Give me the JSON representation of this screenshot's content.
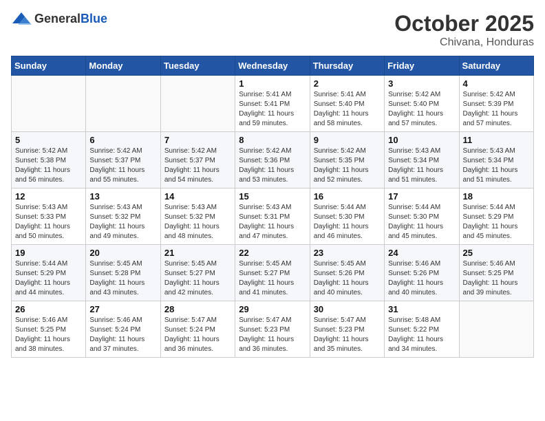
{
  "header": {
    "logo_general": "General",
    "logo_blue": "Blue",
    "month": "October 2025",
    "location": "Chivana, Honduras"
  },
  "weekdays": [
    "Sunday",
    "Monday",
    "Tuesday",
    "Wednesday",
    "Thursday",
    "Friday",
    "Saturday"
  ],
  "weeks": [
    [
      {
        "day": "",
        "info": ""
      },
      {
        "day": "",
        "info": ""
      },
      {
        "day": "",
        "info": ""
      },
      {
        "day": "1",
        "info": "Sunrise: 5:41 AM\nSunset: 5:41 PM\nDaylight: 11 hours\nand 59 minutes."
      },
      {
        "day": "2",
        "info": "Sunrise: 5:41 AM\nSunset: 5:40 PM\nDaylight: 11 hours\nand 58 minutes."
      },
      {
        "day": "3",
        "info": "Sunrise: 5:42 AM\nSunset: 5:40 PM\nDaylight: 11 hours\nand 57 minutes."
      },
      {
        "day": "4",
        "info": "Sunrise: 5:42 AM\nSunset: 5:39 PM\nDaylight: 11 hours\nand 57 minutes."
      }
    ],
    [
      {
        "day": "5",
        "info": "Sunrise: 5:42 AM\nSunset: 5:38 PM\nDaylight: 11 hours\nand 56 minutes."
      },
      {
        "day": "6",
        "info": "Sunrise: 5:42 AM\nSunset: 5:37 PM\nDaylight: 11 hours\nand 55 minutes."
      },
      {
        "day": "7",
        "info": "Sunrise: 5:42 AM\nSunset: 5:37 PM\nDaylight: 11 hours\nand 54 minutes."
      },
      {
        "day": "8",
        "info": "Sunrise: 5:42 AM\nSunset: 5:36 PM\nDaylight: 11 hours\nand 53 minutes."
      },
      {
        "day": "9",
        "info": "Sunrise: 5:42 AM\nSunset: 5:35 PM\nDaylight: 11 hours\nand 52 minutes."
      },
      {
        "day": "10",
        "info": "Sunrise: 5:43 AM\nSunset: 5:34 PM\nDaylight: 11 hours\nand 51 minutes."
      },
      {
        "day": "11",
        "info": "Sunrise: 5:43 AM\nSunset: 5:34 PM\nDaylight: 11 hours\nand 51 minutes."
      }
    ],
    [
      {
        "day": "12",
        "info": "Sunrise: 5:43 AM\nSunset: 5:33 PM\nDaylight: 11 hours\nand 50 minutes."
      },
      {
        "day": "13",
        "info": "Sunrise: 5:43 AM\nSunset: 5:32 PM\nDaylight: 11 hours\nand 49 minutes."
      },
      {
        "day": "14",
        "info": "Sunrise: 5:43 AM\nSunset: 5:32 PM\nDaylight: 11 hours\nand 48 minutes."
      },
      {
        "day": "15",
        "info": "Sunrise: 5:43 AM\nSunset: 5:31 PM\nDaylight: 11 hours\nand 47 minutes."
      },
      {
        "day": "16",
        "info": "Sunrise: 5:44 AM\nSunset: 5:30 PM\nDaylight: 11 hours\nand 46 minutes."
      },
      {
        "day": "17",
        "info": "Sunrise: 5:44 AM\nSunset: 5:30 PM\nDaylight: 11 hours\nand 45 minutes."
      },
      {
        "day": "18",
        "info": "Sunrise: 5:44 AM\nSunset: 5:29 PM\nDaylight: 11 hours\nand 45 minutes."
      }
    ],
    [
      {
        "day": "19",
        "info": "Sunrise: 5:44 AM\nSunset: 5:29 PM\nDaylight: 11 hours\nand 44 minutes."
      },
      {
        "day": "20",
        "info": "Sunrise: 5:45 AM\nSunset: 5:28 PM\nDaylight: 11 hours\nand 43 minutes."
      },
      {
        "day": "21",
        "info": "Sunrise: 5:45 AM\nSunset: 5:27 PM\nDaylight: 11 hours\nand 42 minutes."
      },
      {
        "day": "22",
        "info": "Sunrise: 5:45 AM\nSunset: 5:27 PM\nDaylight: 11 hours\nand 41 minutes."
      },
      {
        "day": "23",
        "info": "Sunrise: 5:45 AM\nSunset: 5:26 PM\nDaylight: 11 hours\nand 40 minutes."
      },
      {
        "day": "24",
        "info": "Sunrise: 5:46 AM\nSunset: 5:26 PM\nDaylight: 11 hours\nand 40 minutes."
      },
      {
        "day": "25",
        "info": "Sunrise: 5:46 AM\nSunset: 5:25 PM\nDaylight: 11 hours\nand 39 minutes."
      }
    ],
    [
      {
        "day": "26",
        "info": "Sunrise: 5:46 AM\nSunset: 5:25 PM\nDaylight: 11 hours\nand 38 minutes."
      },
      {
        "day": "27",
        "info": "Sunrise: 5:46 AM\nSunset: 5:24 PM\nDaylight: 11 hours\nand 37 minutes."
      },
      {
        "day": "28",
        "info": "Sunrise: 5:47 AM\nSunset: 5:24 PM\nDaylight: 11 hours\nand 36 minutes."
      },
      {
        "day": "29",
        "info": "Sunrise: 5:47 AM\nSunset: 5:23 PM\nDaylight: 11 hours\nand 36 minutes."
      },
      {
        "day": "30",
        "info": "Sunrise: 5:47 AM\nSunset: 5:23 PM\nDaylight: 11 hours\nand 35 minutes."
      },
      {
        "day": "31",
        "info": "Sunrise: 5:48 AM\nSunset: 5:22 PM\nDaylight: 11 hours\nand 34 minutes."
      },
      {
        "day": "",
        "info": ""
      }
    ]
  ]
}
